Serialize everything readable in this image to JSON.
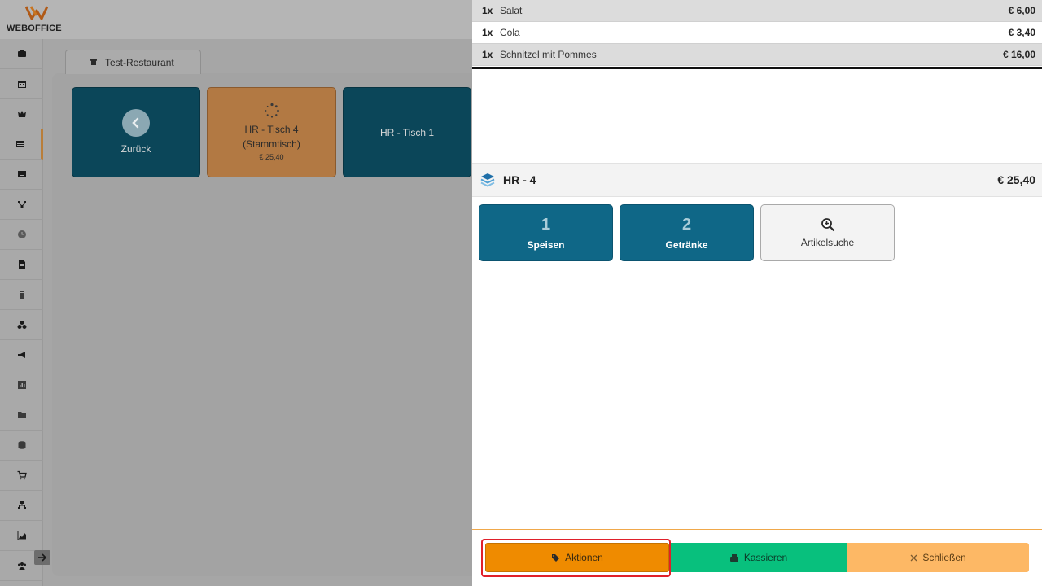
{
  "app": {
    "brand_name": "WEBOFFICE",
    "tab_label": "Test-Restaurant"
  },
  "sidebar": {
    "items": [
      {
        "icon": "register-icon"
      },
      {
        "icon": "calendar-icon"
      },
      {
        "icon": "crown-icon"
      },
      {
        "icon": "table-icon",
        "active": true
      },
      {
        "icon": "list-icon"
      },
      {
        "icon": "network-icon"
      },
      {
        "icon": "clock-icon"
      },
      {
        "icon": "document-icon"
      },
      {
        "icon": "receipt-icon"
      },
      {
        "icon": "cubes-icon"
      },
      {
        "icon": "megaphone-icon"
      },
      {
        "icon": "chart-icon"
      },
      {
        "icon": "folder-icon"
      },
      {
        "icon": "database-icon"
      },
      {
        "icon": "cart-icon"
      },
      {
        "icon": "sitemap-icon"
      },
      {
        "icon": "area-chart-icon"
      },
      {
        "icon": "users-icon"
      }
    ]
  },
  "tiles": {
    "back": {
      "label": "Zurück"
    },
    "table4": {
      "line1": "HR - Tisch 4",
      "line2": "(Stammtisch)",
      "price": "€ 25,40"
    },
    "table1": {
      "label": "HR - Tisch 1"
    }
  },
  "order": {
    "items": [
      {
        "qty": "1x",
        "name": "Salat",
        "price": "€ 6,00"
      },
      {
        "qty": "1x",
        "name": "Cola",
        "price": "€ 3,40"
      },
      {
        "qty": "1x",
        "name": "Schnitzel mit Pommes",
        "price": "€ 16,00"
      }
    ]
  },
  "summary": {
    "title": "HR - 4",
    "total": "€ 25,40"
  },
  "categories": [
    {
      "num": "1",
      "label": "Speisen"
    },
    {
      "num": "2",
      "label": "Getränke"
    },
    {
      "label": "Artikelsuche"
    }
  ],
  "actions": {
    "aktionen": "Aktionen",
    "kassieren": "Kassieren",
    "schliessen": "Schließen"
  },
  "colors": {
    "accent_orange": "#ef8b00",
    "accent_green": "#08c07d",
    "accent_light_orange": "#fdb865",
    "tile_blue": "#0f6787",
    "highlight_red": "#e0202a"
  }
}
